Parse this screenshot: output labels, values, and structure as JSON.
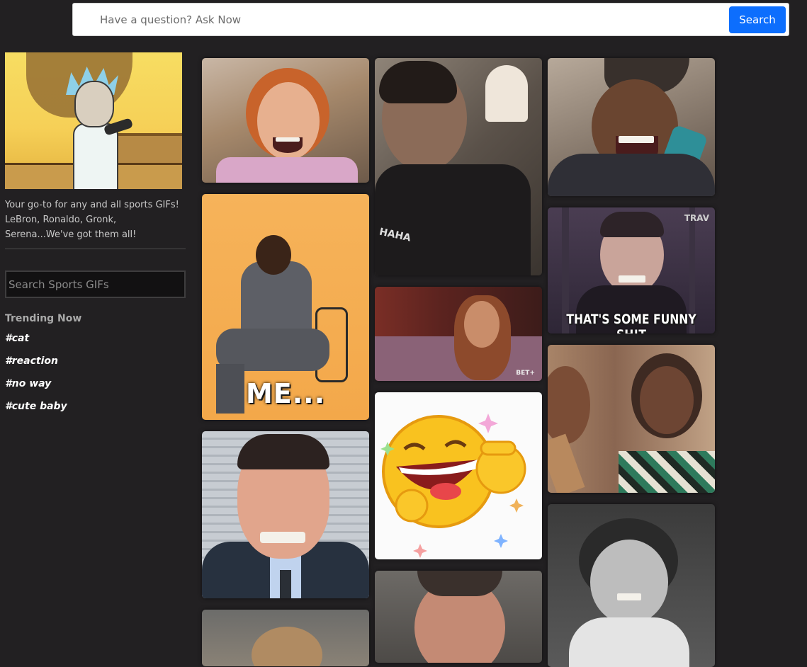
{
  "search": {
    "placeholder": "Have a question? Ask Now",
    "button_label": "Search",
    "button_color": "#0d6efd"
  },
  "sidebar": {
    "tagline": "Your go-to for any and all sports GIFs! LeBron, Ronaldo, Gronk, Serena...We've got them all!",
    "search_placeholder": "Search Sports GIFs",
    "trending_title": "Trending Now",
    "tags": [
      "#cat",
      "#reaction",
      "#no way",
      "#cute baby"
    ]
  },
  "gifs": {
    "col1": {
      "tile2_caption": "ME..."
    },
    "col2": {
      "tile1_overlay": "HAHA",
      "tile2_watermark": "BET+"
    },
    "col3": {
      "tile2_caption": "THAT'S SOME FUNNY SH!T",
      "tile2_watermark": "TRAV"
    }
  },
  "colors": {
    "page_background": "#222022",
    "sidebar_text": "#c9c9c9",
    "tag_text": "#ffffff"
  }
}
